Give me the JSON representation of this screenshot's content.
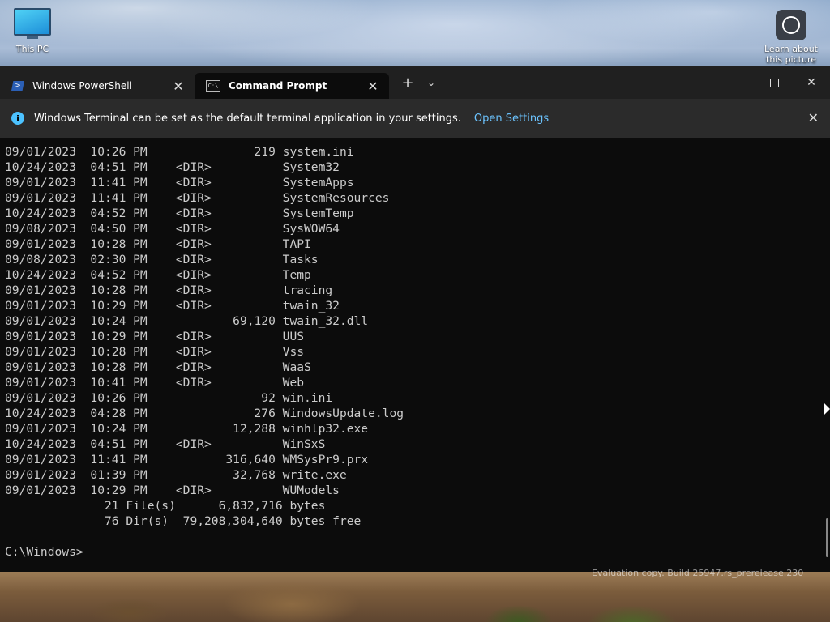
{
  "desktop": {
    "icons": [
      {
        "label": "This PC",
        "icon": "this-pc-icon"
      },
      {
        "label": "Learn about this picture",
        "icon": "learn-icon"
      }
    ],
    "watermark": "Evaluation copy. Build 25947.rs_prerelease.230"
  },
  "terminal": {
    "tabs": [
      {
        "label": "Windows PowerShell",
        "icon": "powershell-icon",
        "active": false
      },
      {
        "label": "Command Prompt",
        "icon": "cmd-icon",
        "active": true
      }
    ],
    "new_tab": "+",
    "dropdown": "⌄",
    "caption": {
      "minimize": "—",
      "maximize": "□",
      "close": "✕"
    },
    "infobar": {
      "message": "Windows Terminal can be set as the default terminal application in your settings.",
      "link": "Open Settings",
      "close": "✕"
    },
    "colors": {
      "background": "#0c0c0c",
      "text": "#cccccc",
      "link": "#6cc4ff",
      "info_icon": "#4cc2ff"
    },
    "console_lines": [
      "09/01/2023  10:26 PM               219 system.ini",
      "10/24/2023  04:51 PM    <DIR>          System32",
      "09/01/2023  11:41 PM    <DIR>          SystemApps",
      "09/01/2023  11:41 PM    <DIR>          SystemResources",
      "10/24/2023  04:52 PM    <DIR>          SystemTemp",
      "09/08/2023  04:50 PM    <DIR>          SysWOW64",
      "09/01/2023  10:28 PM    <DIR>          TAPI",
      "09/08/2023  02:30 PM    <DIR>          Tasks",
      "10/24/2023  04:52 PM    <DIR>          Temp",
      "09/01/2023  10:28 PM    <DIR>          tracing",
      "09/01/2023  10:29 PM    <DIR>          twain_32",
      "09/01/2023  10:24 PM            69,120 twain_32.dll",
      "09/01/2023  10:29 PM    <DIR>          UUS",
      "09/01/2023  10:28 PM    <DIR>          Vss",
      "09/01/2023  10:28 PM    <DIR>          WaaS",
      "09/01/2023  10:41 PM    <DIR>          Web",
      "09/01/2023  10:26 PM                92 win.ini",
      "10/24/2023  04:28 PM               276 WindowsUpdate.log",
      "09/01/2023  10:24 PM            12,288 winhlp32.exe",
      "10/24/2023  04:51 PM    <DIR>          WinSxS",
      "09/01/2023  11:41 PM           316,640 WMSysPr9.prx",
      "09/01/2023  01:39 PM            32,768 write.exe",
      "09/01/2023  10:29 PM    <DIR>          WUModels",
      "              21 File(s)      6,832,716 bytes",
      "              76 Dir(s)  79,208,304,640 bytes free",
      "",
      "C:\\Windows>"
    ]
  }
}
